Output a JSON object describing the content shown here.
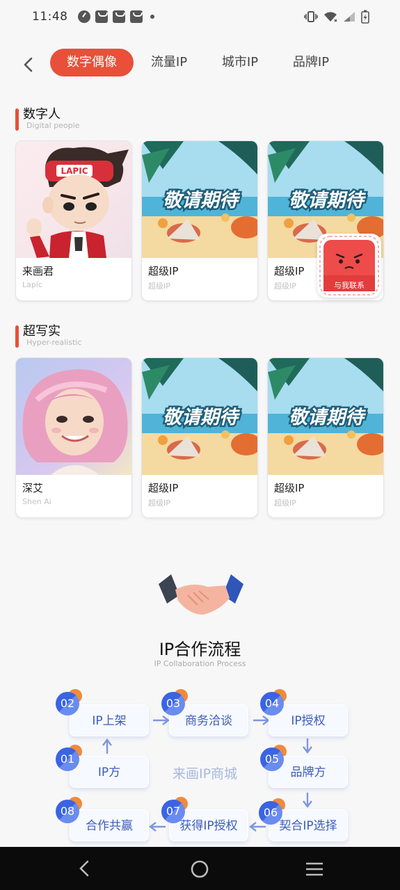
{
  "status_bar": {
    "time": "11:48"
  },
  "tabs": [
    {
      "label": "数字偶像",
      "active": true
    },
    {
      "label": "流量IP",
      "active": false
    },
    {
      "label": "城市IP",
      "active": false
    },
    {
      "label": "品牌IP",
      "active": false
    }
  ],
  "sections": [
    {
      "title": "数字人",
      "subtitle": "Digital people",
      "cards": [
        {
          "title": "来画君",
          "subtitle": "Lapic"
        },
        {
          "title": "超级IP",
          "subtitle": "超级IP",
          "image_text": "敬请期待"
        },
        {
          "title": "超级IP",
          "subtitle": "超级IP",
          "image_text": "敬请期待"
        }
      ]
    },
    {
      "title": "超写实",
      "subtitle": "Hyper-realistic",
      "cards": [
        {
          "title": "深艾",
          "subtitle": "Shen Ai"
        },
        {
          "title": "超级IP",
          "subtitle": "超级IP",
          "image_text": "敬请期待"
        },
        {
          "title": "超级IP",
          "subtitle": "超级IP",
          "image_text": "敬请期待"
        }
      ]
    }
  ],
  "mascot_cap_text": "LAPIC",
  "contact_badge": {
    "label": "与我联系"
  },
  "process": {
    "title": "IP合作流程",
    "subtitle": "IP Collaboration Process",
    "center_label": "来画IP商城",
    "steps": [
      {
        "num": "01",
        "label": "IP方"
      },
      {
        "num": "02",
        "label": "IP上架"
      },
      {
        "num": "03",
        "label": "商务洽谈"
      },
      {
        "num": "04",
        "label": "IP授权"
      },
      {
        "num": "05",
        "label": "品牌方"
      },
      {
        "num": "06",
        "label": "契合IP选择"
      },
      {
        "num": "07",
        "label": "获得IP授权"
      },
      {
        "num": "08",
        "label": "合作共赢"
      }
    ]
  },
  "icons": [
    "back-icon",
    "wifi-icon",
    "signal-icon",
    "battery-icon",
    "vibrate-icon",
    "nav-back-icon",
    "nav-home-icon",
    "nav-menu-icon"
  ],
  "colors": {
    "accent": "#e8503a",
    "process_blue": "#3d5db8",
    "badge_orange": "#f08a3c"
  }
}
